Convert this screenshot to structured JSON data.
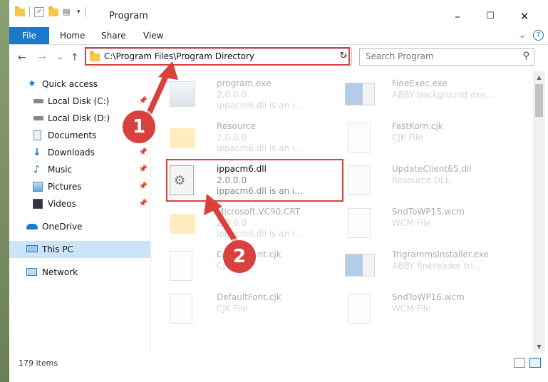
{
  "window": {
    "title": "Program",
    "minimize": "–",
    "maximize": "☐",
    "close": "✕"
  },
  "ribbon": {
    "tabs": [
      "File",
      "Home",
      "Share",
      "View"
    ],
    "chevron": "⌄",
    "help": "?"
  },
  "address": {
    "path": "C:\\Program Files\\Program Directory",
    "back": "←",
    "forward": "→",
    "recent": "⌄",
    "up": "↑",
    "refresh": "↻",
    "dropdown": "⌄"
  },
  "search": {
    "placeholder": "Search Program",
    "icon": "⚲"
  },
  "sidebar": {
    "items": [
      {
        "label": "Quick access",
        "icon": "star-icon",
        "pinned": false
      },
      {
        "label": "Local Disk (C:)",
        "icon": "drive-icon",
        "pinned": true
      },
      {
        "label": "Local Disk (D:)",
        "icon": "drive-icon",
        "pinned": true
      },
      {
        "label": "Documents",
        "icon": "documents-icon",
        "pinned": true
      },
      {
        "label": "Downloads",
        "icon": "downloads-icon",
        "pinned": true
      },
      {
        "label": "Music",
        "icon": "music-icon",
        "pinned": true
      },
      {
        "label": "Pictures",
        "icon": "pictures-icon",
        "pinned": true
      },
      {
        "label": "Videos",
        "icon": "videos-icon",
        "pinned": true
      },
      {
        "label": "OneDrive",
        "icon": "onedrive-icon",
        "pinned": false
      },
      {
        "label": "This PC",
        "icon": "pc-icon",
        "pinned": false,
        "selected": true
      },
      {
        "label": "Network",
        "icon": "network-icon",
        "pinned": false
      }
    ],
    "pin_glyph": "📌"
  },
  "files": {
    "left": [
      {
        "name": "program.exe",
        "l2": "2.0.0.0",
        "l3": "ippacm6.dll is an i...",
        "kind": "exe"
      },
      {
        "name": "Resource",
        "l2": "2.0.0.0",
        "l3": "ippacm6.dll is an i...",
        "kind": "folder"
      },
      {
        "name": "ippacm6.dll",
        "l2": "2.0.0.0",
        "l3": "ippacm6.dll is an i...",
        "kind": "dll"
      },
      {
        "name": "Microsoft.VC90.CRT",
        "l2": "2.0.0.0",
        "l3": "ippacm6.dll is an i...",
        "kind": "folder"
      },
      {
        "name": "DefaultFont.cjk",
        "l2": "CJK File",
        "l3": "",
        "kind": "file"
      },
      {
        "name": "DefaultFont.cjk",
        "l2": "CJK File",
        "l3": "",
        "kind": "file"
      }
    ],
    "right": [
      {
        "name": "FineExec.exe",
        "l2": "ABBY background exe...",
        "l3": "",
        "kind": "app"
      },
      {
        "name": "FastKorn.cjk",
        "l2": "CJK File",
        "l3": "",
        "kind": "file"
      },
      {
        "name": "UpdateClient65.dll",
        "l2": "Resource DLL",
        "l3": "",
        "kind": "dll"
      },
      {
        "name": "SndToWP15.wcm",
        "l2": "WCM File",
        "l3": "",
        "kind": "file"
      },
      {
        "name": "TrigrammsInstaller.exe",
        "l2": "ABBY finereader tri...",
        "l3": "",
        "kind": "app"
      },
      {
        "name": "SndToWP16.wcm",
        "l2": "WCM File",
        "l3": "",
        "kind": "file"
      }
    ]
  },
  "status": {
    "items": "179 items"
  },
  "callouts": {
    "one": "1",
    "two": "2"
  },
  "colors": {
    "accent": "#1979ca",
    "highlight": "#d9413f",
    "selected": "#cce4f7"
  }
}
